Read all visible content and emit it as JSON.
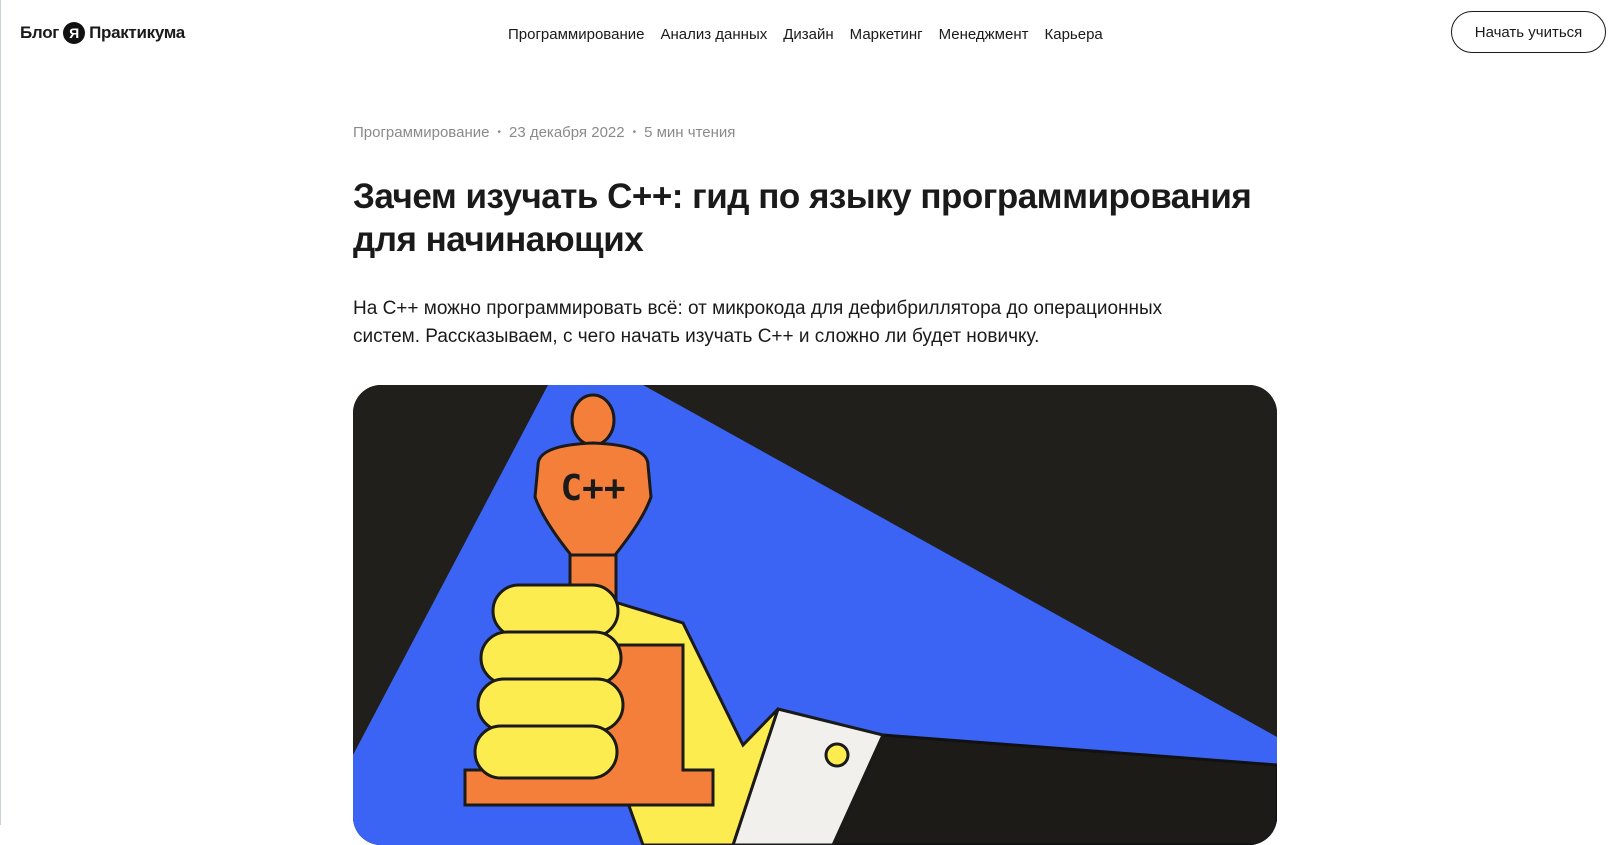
{
  "header": {
    "logo_left": "Блог",
    "logo_badge": "Я",
    "logo_right": "Практикума",
    "nav": [
      "Программирование",
      "Анализ данных",
      "Дизайн",
      "Маркетинг",
      "Менеджмент",
      "Карьера"
    ],
    "cta_label": "Начать учиться"
  },
  "article": {
    "category": "Программирование",
    "date": "23 декабря  2022",
    "read_time": "5 мин чтения",
    "title": "Зачем изучать С++: гид по языку программирования для начинающих",
    "lead": "На С++ можно программировать всё: от микрокода для дефибриллятора до операционных систем. Рассказываем, с чего начать изучать С++ и сложно ли будет новичку.",
    "hero": {
      "trophy_label": "C++",
      "colors": {
        "background": "#201f1b",
        "spotlight": "#3b64f5",
        "trophy": "#f47f3b",
        "hand": "#fdec4f",
        "cuff": "#f1f0ec",
        "sleeve": "#1c1b18"
      }
    }
  }
}
